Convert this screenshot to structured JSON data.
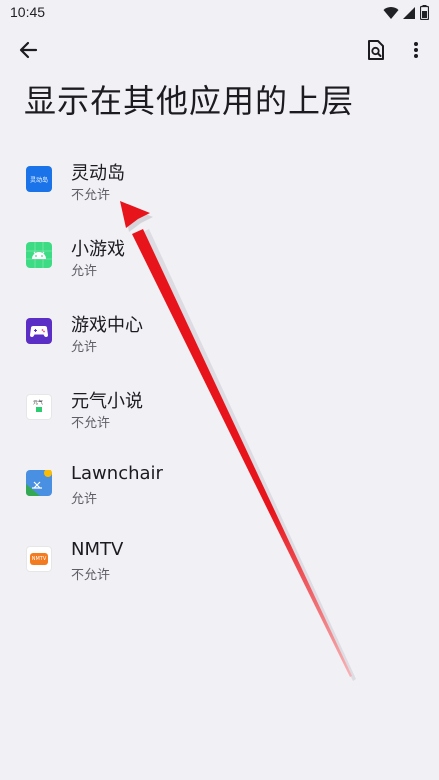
{
  "status_bar": {
    "time": "10:45",
    "icons": [
      "wifi-icon",
      "signal-icon",
      "battery-icon"
    ]
  },
  "top_bar": {
    "back_icon": "arrow-back-icon",
    "search_icon": "search-page-icon",
    "more_icon": "more-vertical-icon"
  },
  "page": {
    "title": "显示在其他应用的上层"
  },
  "apps": [
    {
      "name": "灵动岛",
      "status": "不允许",
      "icon": "dynamic-island-app-icon",
      "icon_text": "灵动岛",
      "icon_color": "#1a73e8"
    },
    {
      "name": "小游戏",
      "status": "允许",
      "icon": "android-app-icon",
      "icon_color": "#3ddc84"
    },
    {
      "name": "游戏中心",
      "status": "允许",
      "icon": "gamepad-app-icon",
      "icon_color": "#5b2ec6"
    },
    {
      "name": "元气小说",
      "status": "不允许",
      "icon": "novel-app-icon",
      "icon_text": "元气",
      "icon_color": "#2ecc71"
    },
    {
      "name": "Lawnchair",
      "status": "允许",
      "icon": "lawnchair-app-icon",
      "icon_color": "#4a90e2"
    },
    {
      "name": "NMTV",
      "status": "不允许",
      "icon": "nmtv-app-icon",
      "icon_text": "NMTV",
      "icon_color": "#f47c20"
    }
  ],
  "annotation": {
    "arrow_color": "#e8141b"
  }
}
